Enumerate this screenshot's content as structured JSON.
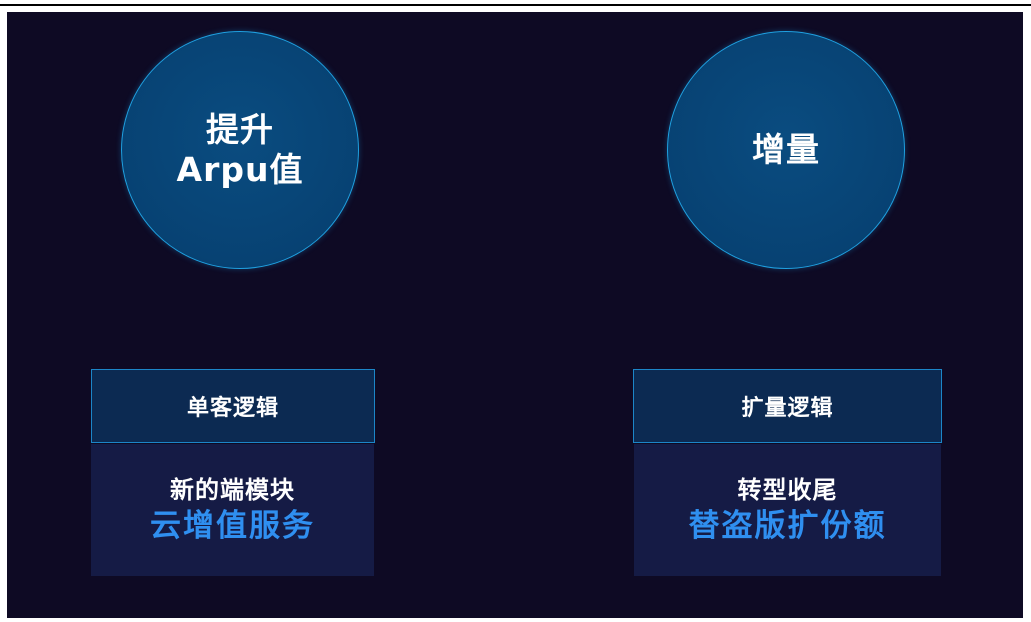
{
  "left": {
    "circle_lines": [
      "提升",
      "Arpu值"
    ],
    "header": "单客逻辑",
    "body_main": "新的端模块",
    "body_accent": "云增值服务"
  },
  "right": {
    "circle_lines": [
      "增量"
    ],
    "header": "扩量逻辑",
    "body_main": "转型收尾",
    "body_accent": "替盗版扩份额"
  },
  "colors": {
    "background": "#0e0a24",
    "circle_fill": "#074273",
    "circle_border": "#1fa0e0",
    "header_fill": "#0c2a52",
    "body_fill": "#151b45",
    "accent_text": "#2f8ff0"
  }
}
